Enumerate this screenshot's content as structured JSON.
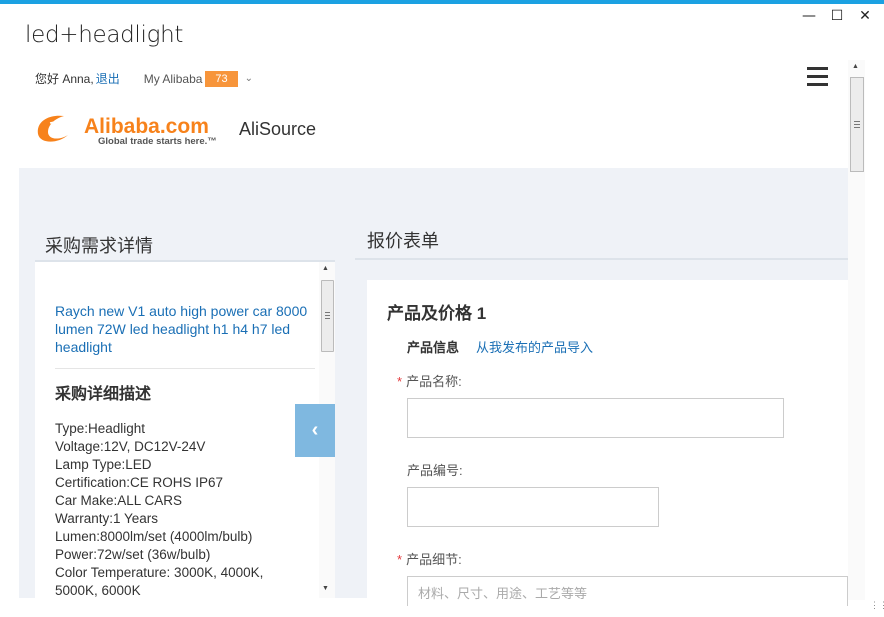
{
  "window": {
    "title": "led+headlight",
    "minimize": "—",
    "maximize": "☐",
    "close": "✕"
  },
  "userbar": {
    "greeting": "您好 Anna,",
    "logout": "退出",
    "my_alibaba": "My Alibaba",
    "badge_count": "73"
  },
  "brand": {
    "logo_text": "Alibaba.com",
    "logo_tagline": "Global trade starts here.™",
    "product": "AliSource",
    "logo_color": "#f7821b"
  },
  "left": {
    "heading": "采购需求详情",
    "title": "Raych new V1 auto high power car 8000 lumen 72W led headlight h1 h4 h7 led headlight",
    "subheading": "采购详细描述",
    "specs": [
      "Type:Headlight",
      "Voltage:12V, DC12V-24V",
      "Lamp Type:LED",
      "Certification:CE ROHS IP67",
      "Car Make:ALL CARS",
      "Warranty:1 Years",
      "Lumen:8000lm/set (4000lm/bulb)",
      "Power:72w/set (36w/bulb)",
      "Color Temperature: 3000K, 4000K,",
      "5000K, 6000K"
    ],
    "collapse_icon": "chevron-left-icon"
  },
  "right": {
    "heading": "报价表单",
    "section_title": "产品及价格 1",
    "product_info_label": "产品信息",
    "import_link": "从我发布的产品导入",
    "name_label": "产品名称:",
    "code_label": "产品编号:",
    "detail_label": "产品细节:",
    "detail_placeholder": "材料、尺寸、用途、工艺等等",
    "required_mark": "*"
  },
  "colors": {
    "accent": "#1ba1e2",
    "link": "#1a6fb5",
    "badge": "#f7953b",
    "panel_bg": "#eff2f7",
    "collapse_btn": "#7fb8e0"
  }
}
